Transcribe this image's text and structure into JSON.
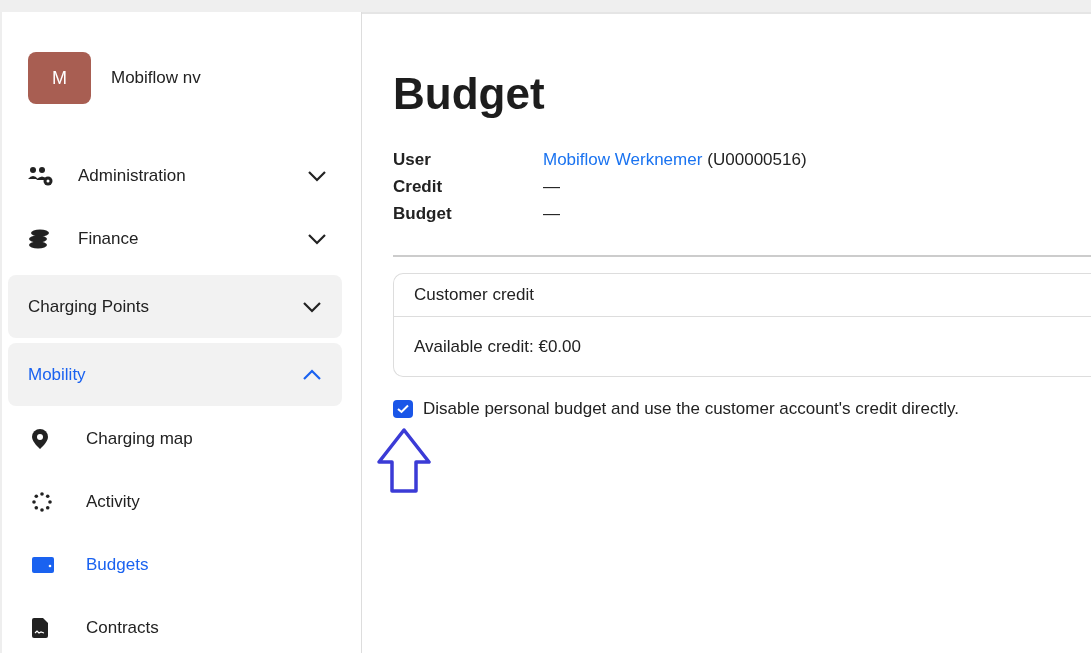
{
  "organization": {
    "avatar_letter": "M",
    "name": "Mobiflow nv"
  },
  "nav": [
    {
      "kind": "item",
      "label": "Administration",
      "expanded": false
    },
    {
      "kind": "item",
      "label": "Finance",
      "expanded": false
    },
    {
      "kind": "group",
      "label": "Charging Points",
      "expanded": false
    },
    {
      "kind": "group",
      "label": "Mobility",
      "expanded": true,
      "children": [
        {
          "label": "Charging map",
          "selected": false
        },
        {
          "label": "Activity",
          "selected": false
        },
        {
          "label": "Budgets",
          "selected": true
        },
        {
          "label": "Contracts",
          "selected": false
        }
      ]
    }
  ],
  "page": {
    "title": "Budget",
    "details": [
      {
        "label": "User",
        "link": "Mobiflow Werknemer",
        "value": "(U00000516)"
      },
      {
        "label": "Credit",
        "value": "—"
      },
      {
        "label": "Budget",
        "value": "—"
      }
    ],
    "card": {
      "title": "Customer credit",
      "body": "Available credit: €0.00"
    },
    "option": {
      "label": "Disable personal budget and use the customer account's credit directly.",
      "checked": true
    }
  }
}
